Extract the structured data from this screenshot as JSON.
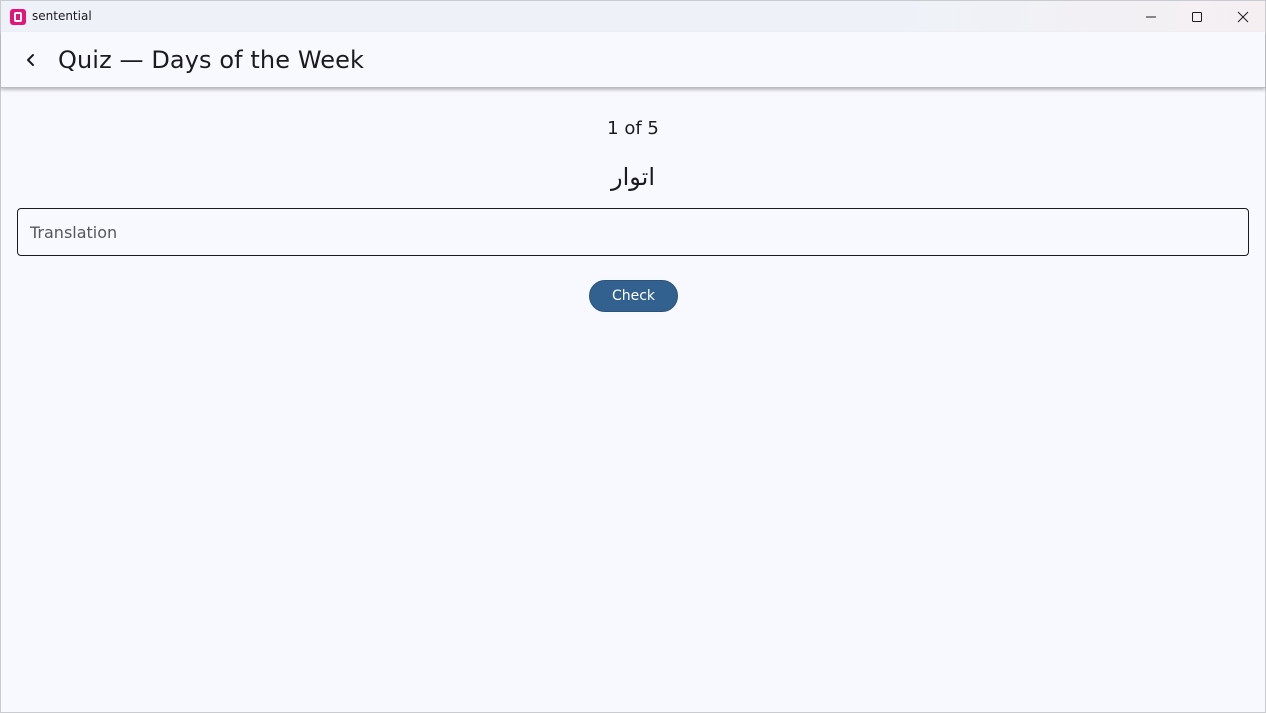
{
  "window": {
    "app_name": "sentential",
    "accent": "#e5147a",
    "controls": [
      "minimize-icon",
      "maximize-icon",
      "close-icon"
    ]
  },
  "header": {
    "back_icon": "chevron-left-icon",
    "title": "Quiz — Days of the Week"
  },
  "quiz": {
    "progress_text": "1 of 5",
    "word": "اتوار",
    "input_placeholder": "Translation",
    "input_value": "",
    "check_label": "Check",
    "button_color": "#33618f"
  }
}
